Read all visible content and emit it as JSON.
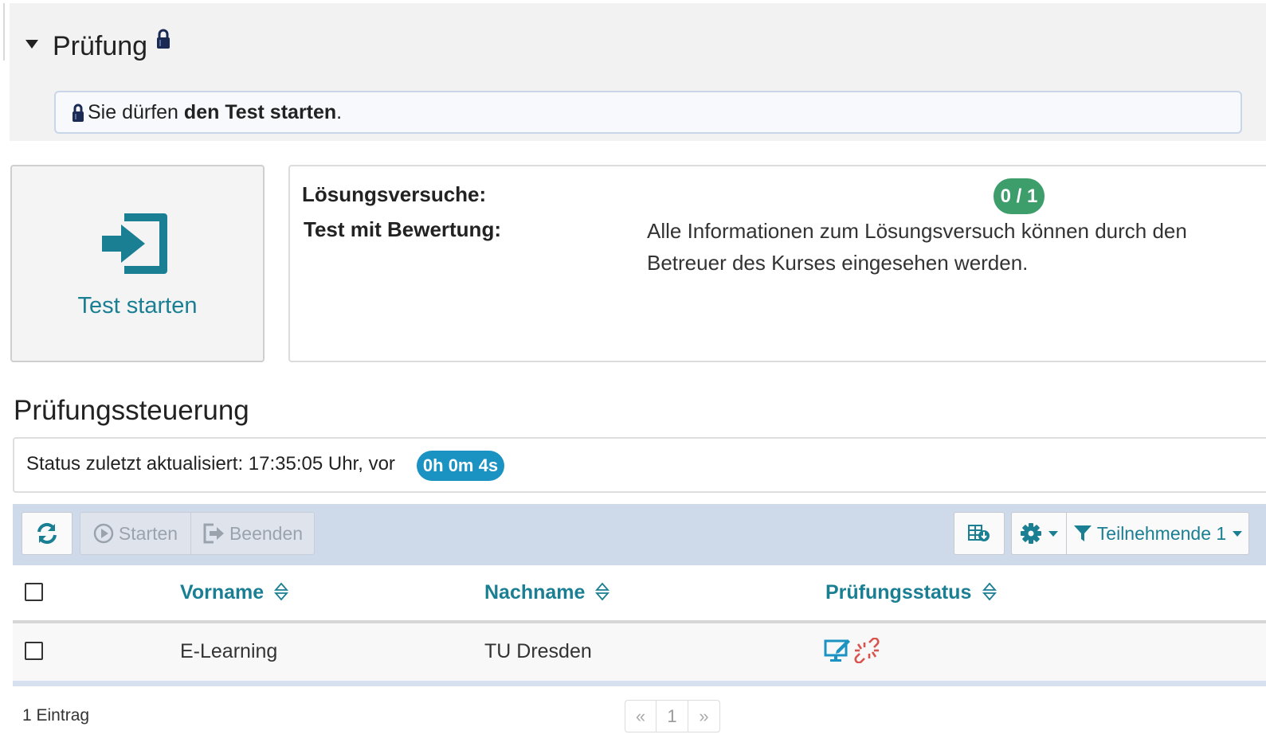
{
  "assessment": {
    "section_title": "Prüfung",
    "notice": {
      "prefix": "Sie dürfen ",
      "bold": "den Test starten",
      "suffix": "."
    }
  },
  "start_tile": {
    "label": "Test starten",
    "icon": "sign-in-icon"
  },
  "info": {
    "attempts_label": "Lösungsversuche:",
    "attempts_value": "0 / 1",
    "graded_label": "Test mit Bewertung:",
    "graded_value": "Alle Informationen zum Lösungsversuch können durch den Betreuer des Kurses eingesehen werden."
  },
  "control": {
    "title": "Prüfungssteuerung",
    "status_text": "Status zuletzt aktualisiert: 17:35:05 Uhr, vor",
    "elapsed": "0h 0m 4s"
  },
  "toolbar": {
    "refresh_icon": "refresh-icon",
    "start_label": "Starten",
    "end_label": "Beenden",
    "export_icon": "table-export-icon",
    "settings_icon": "gear-icon",
    "filter_label": "Teilnehmende 1"
  },
  "table": {
    "columns": [
      "Vorname",
      "Nachname",
      "Prüfungsstatus"
    ],
    "rows": [
      {
        "vorname": "E-Learning",
        "nachname": "TU Dresden",
        "status_icons": [
          "monitor-edit-icon",
          "broken-link-icon"
        ]
      }
    ]
  },
  "footer": {
    "count": "1 Eintrag",
    "prev": "«",
    "page": "1",
    "next": "»"
  },
  "colors": {
    "accent": "#1b7f93",
    "badge_green": "#3e9e6b",
    "badge_blue": "#1a93c3",
    "toolbar_bg": "#ced9ea"
  }
}
